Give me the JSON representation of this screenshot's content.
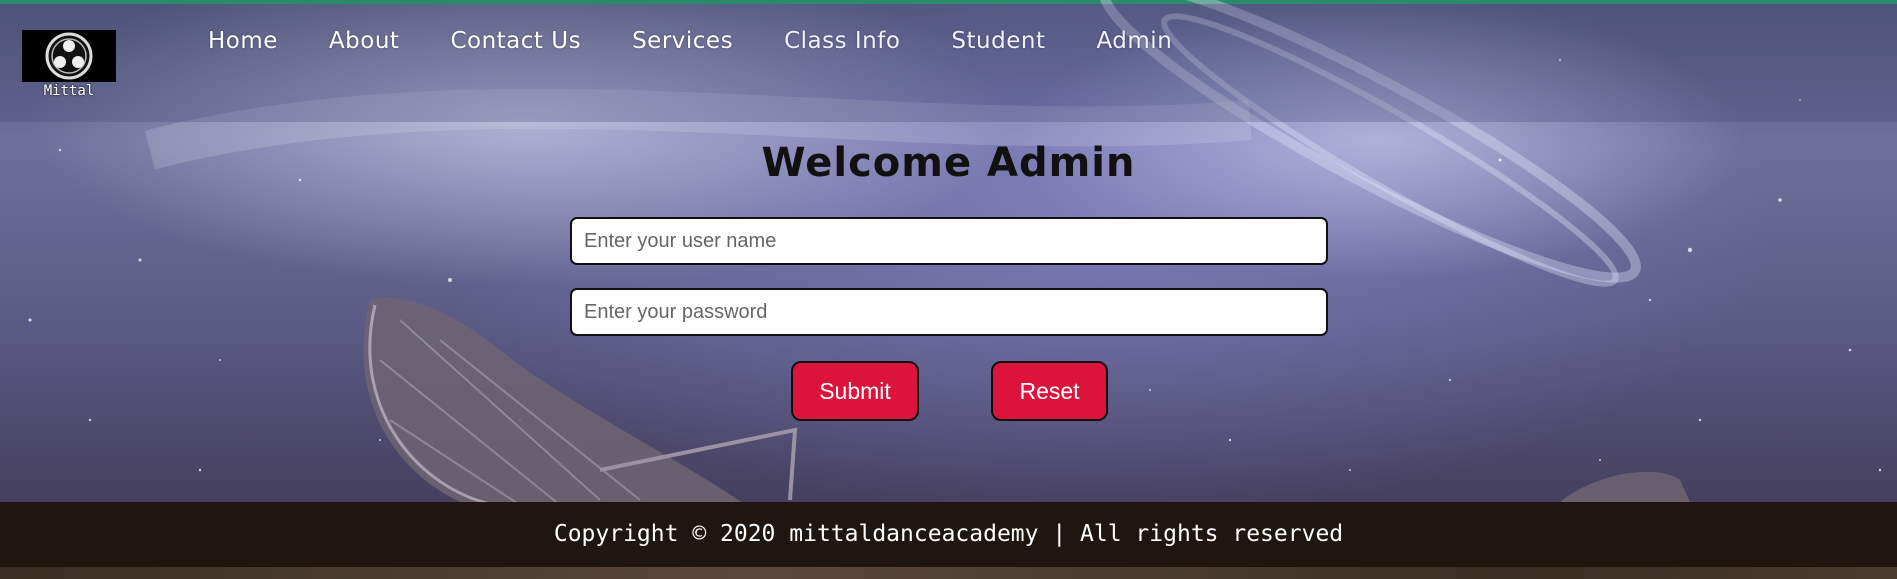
{
  "brand": {
    "logo_text": "Mittal"
  },
  "nav": {
    "items": [
      {
        "label": "Home"
      },
      {
        "label": "About"
      },
      {
        "label": "Contact Us"
      },
      {
        "label": "Services"
      },
      {
        "label": "Class Info"
      },
      {
        "label": "Student"
      },
      {
        "label": "Admin"
      }
    ]
  },
  "login": {
    "title": "Welcome Admin",
    "username_placeholder": "Enter your user name",
    "username_value": "",
    "password_placeholder": "Enter your password",
    "password_value": "",
    "submit_label": "Submit",
    "reset_label": "Reset"
  },
  "footer": {
    "text": "Copyright © 2020 mittaldanceacademy | All rights reserved"
  },
  "colors": {
    "accent_button": "#dc143c",
    "footer_bg": "#1f170f",
    "top_accent": "#2b8a6a"
  }
}
